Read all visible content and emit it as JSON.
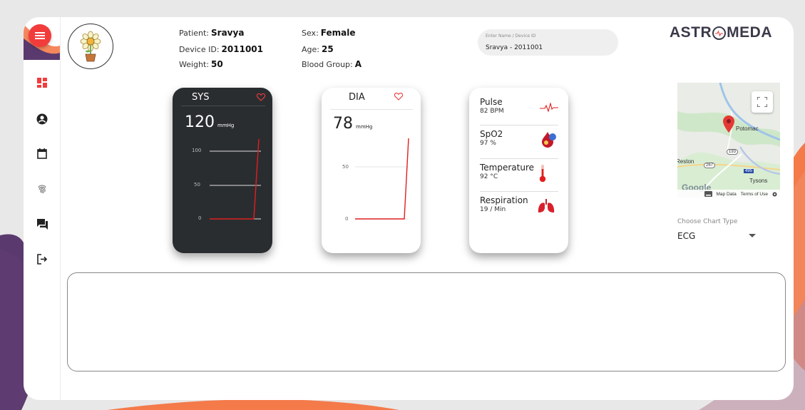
{
  "patient": {
    "patient_label": "Patient:",
    "patient_value": "Sravya",
    "device_label": "Device ID:",
    "device_value": "2011001",
    "weight_label": "Weight:",
    "weight_value": "50",
    "sex_label": "Sex:",
    "sex_value": "Female",
    "age_label": "Age:",
    "age_value": "25",
    "blood_label": "Blood Group:",
    "blood_value": "A"
  },
  "search": {
    "placeholder": "Enter Name / Device ID",
    "value": "Sravya - 2011001"
  },
  "logo": {
    "left": "ASTR",
    "right": "MEDA"
  },
  "sys": {
    "title": "SYS",
    "value": "120",
    "unit": "mmHg",
    "ticks": [
      "100",
      "50",
      "0"
    ]
  },
  "dia": {
    "title": "DIA",
    "value": "78",
    "unit": "mmHg",
    "ticks": [
      "50",
      "0"
    ]
  },
  "vitals": [
    {
      "name": "Pulse",
      "value": "82 BPM"
    },
    {
      "name": "SpO2",
      "value": "97 %"
    },
    {
      "name": "Temperature",
      "value": "92 °C"
    },
    {
      "name": "Respiration",
      "value": "19 / Min"
    }
  ],
  "map": {
    "labels": [
      "Potomac",
      "Reston",
      "Tysons",
      "193",
      "267",
      "495",
      "Map Data",
      "Terms of Use",
      "Google"
    ]
  },
  "chart_type": {
    "label": "Choose Chart Type",
    "value": "ECG"
  },
  "colors": {
    "accent_red": "#f23c3c",
    "dark_card": "#2a2d30",
    "orange": "#f47a4a",
    "purple": "#5a3a6e"
  }
}
